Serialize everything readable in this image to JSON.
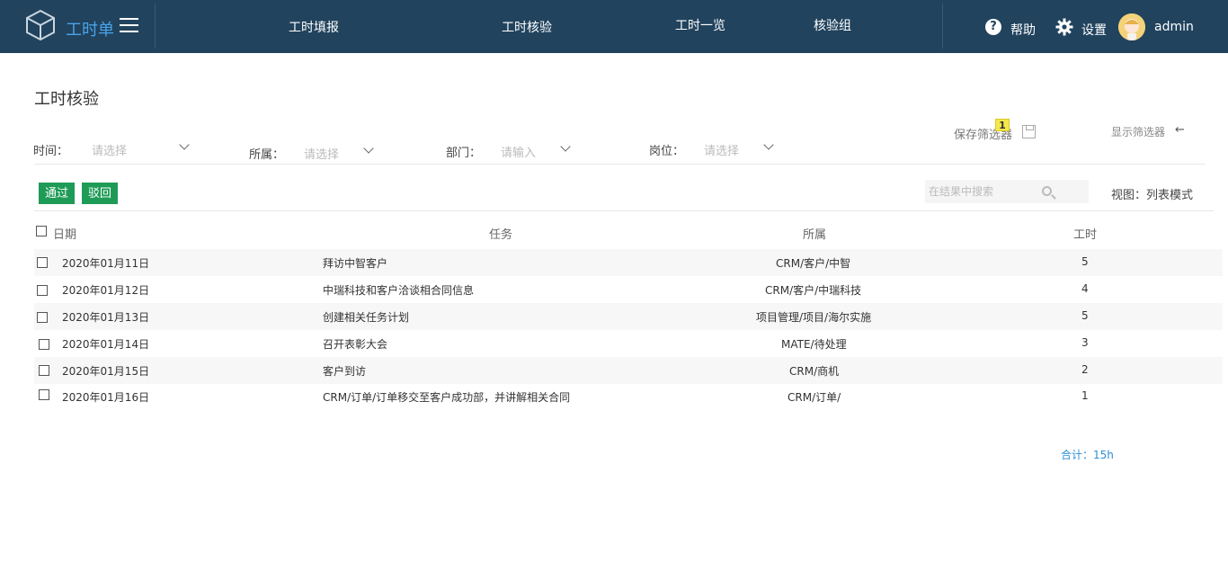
{
  "header": {
    "brand": "工时单",
    "nav": [
      "工时填报",
      "工时核验",
      "工时一览",
      "核验组"
    ],
    "help_label": "帮助",
    "settings_label": "设置",
    "user_name": "admin"
  },
  "page": {
    "title": "工时核验",
    "save_filter_label": "保存筛选器",
    "save_filter_badge": "1",
    "show_filter_label": "显示筛选器",
    "show_filter_arrow": "←"
  },
  "filters": [
    {
      "label": "时间：",
      "placeholder": "请选择"
    },
    {
      "label": "所属：",
      "placeholder": "请选择"
    },
    {
      "label": "部门：",
      "placeholder": "请输入"
    },
    {
      "label": "岗位：",
      "placeholder": "请选择"
    }
  ],
  "actions": {
    "approve_label": "通过",
    "reject_label": "驳回",
    "search_placeholder": "在结果中搜索",
    "view_mode": "视图：列表模式"
  },
  "table": {
    "columns": [
      "日期",
      "任务",
      "所属",
      "工时"
    ],
    "rows": [
      {
        "date": "2020年01月11日",
        "task": "拜访中智客户",
        "belong": "CRM/客户/中智",
        "hours": "5"
      },
      {
        "date": "2020年01月12日",
        "task": "中瑞科技和客户洽谈相合同信息",
        "belong": "CRM/客户/中瑞科技",
        "hours": "4"
      },
      {
        "date": "2020年01月13日",
        "task": "创建相关任务计划",
        "belong": "项目管理/项目/海尔实施",
        "hours": "5"
      },
      {
        "date": "2020年01月14日",
        "task": "召开表彰大会",
        "belong": "MATE/待处理",
        "hours": "3"
      },
      {
        "date": "2020年01月15日",
        "task": "客户到访",
        "belong": "CRM/商机",
        "hours": "2"
      },
      {
        "date": "2020年01月16日",
        "task": "CRM/订单/订单移交至客户成功部，并讲解相关合同",
        "belong": "CRM/订单/",
        "hours": "1"
      }
    ]
  },
  "summary": {
    "total": "合计：15h"
  },
  "colors": {
    "header_bg": "#21435e",
    "brand": "#4aa3e8",
    "button_green": "#1e9b56",
    "total_blue": "#2c8fd6",
    "badge_yellow": "#f5e84b"
  }
}
